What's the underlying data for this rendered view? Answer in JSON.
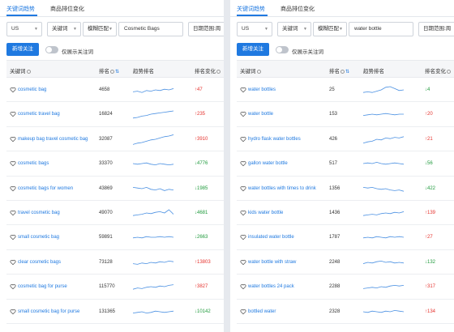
{
  "panels": [
    {
      "tabs": [
        "关键词趋势",
        "商品排位变化"
      ],
      "site": "US",
      "field": "关键词",
      "match": "模糊匹配",
      "query": "Cosmetic Bags",
      "range": "日期范围:周",
      "add_label": "新增关注",
      "toggle_label": "仅展示关注词",
      "headers": {
        "keyword": "关键词",
        "rank": "排名",
        "trend": "趋势排名",
        "change": "排名变化"
      },
      "rows": [
        {
          "keyword": "cosmetic bag",
          "rank": "4658",
          "change": "↑47",
          "dir": "up",
          "trend": [
            0.35,
            0.4,
            0.3,
            0.45,
            0.4,
            0.5,
            0.45,
            0.55,
            0.5,
            0.6
          ]
        },
        {
          "keyword": "cosmetic travel bag",
          "rank": "16824",
          "change": "↑235",
          "dir": "up",
          "trend": [
            0.2,
            0.25,
            0.35,
            0.4,
            0.5,
            0.55,
            0.6,
            0.65,
            0.7,
            0.75
          ]
        },
        {
          "keyword": "makeup bag travel cosmetic bag",
          "rank": "32087",
          "change": "↑3910",
          "dir": "up",
          "trend": [
            0.1,
            0.2,
            0.25,
            0.35,
            0.45,
            0.5,
            0.6,
            0.7,
            0.75,
            0.85
          ]
        },
        {
          "keyword": "cosmetic bags",
          "rank": "33370",
          "change": "↓4776",
          "dir": "down",
          "trend": [
            0.5,
            0.45,
            0.5,
            0.55,
            0.45,
            0.4,
            0.5,
            0.45,
            0.4,
            0.45
          ]
        },
        {
          "keyword": "cosmetic bags for women",
          "rank": "43869",
          "change": "↓1985",
          "dir": "down",
          "trend": [
            0.6,
            0.55,
            0.5,
            0.6,
            0.45,
            0.4,
            0.5,
            0.35,
            0.45,
            0.4
          ]
        },
        {
          "keyword": "travel cosmetic bag",
          "rank": "49070",
          "change": "↓4681",
          "dir": "down",
          "trend": [
            0.3,
            0.35,
            0.4,
            0.5,
            0.45,
            0.55,
            0.6,
            0.5,
            0.75,
            0.4
          ]
        },
        {
          "keyword": "small cosmetic bag",
          "rank": "59891",
          "change": "↓2663",
          "dir": "down",
          "trend": [
            0.45,
            0.5,
            0.45,
            0.55,
            0.5,
            0.5,
            0.55,
            0.5,
            0.55,
            0.5
          ]
        },
        {
          "keyword": "clear cosmetic bags",
          "rank": "73128",
          "change": "↑13803",
          "dir": "up",
          "trend": [
            0.4,
            0.35,
            0.45,
            0.4,
            0.5,
            0.45,
            0.55,
            0.5,
            0.6,
            0.55
          ]
        },
        {
          "keyword": "cosmetic bag for purse",
          "rank": "115770",
          "change": "↑3827",
          "dir": "up",
          "trend": [
            0.3,
            0.4,
            0.35,
            0.45,
            0.5,
            0.45,
            0.55,
            0.5,
            0.6,
            0.65
          ]
        },
        {
          "keyword": "small cosmetic bag for purse",
          "rank": "131365",
          "change": "↓10142",
          "dir": "down",
          "trend": [
            0.4,
            0.45,
            0.5,
            0.4,
            0.45,
            0.55,
            0.5,
            0.45,
            0.5,
            0.55
          ]
        }
      ]
    },
    {
      "tabs": [
        "关键词趋势",
        "商品排位变化"
      ],
      "site": "US",
      "field": "关键词",
      "match": "模糊匹配",
      "query": "water bottle",
      "range": "日期范围:周",
      "add_label": "新增关注",
      "toggle_label": "仅展示关注词",
      "headers": {
        "keyword": "关键词",
        "rank": "排名",
        "trend": "趋势排名",
        "change": "排名变化"
      },
      "rows": [
        {
          "keyword": "water bottles",
          "rank": "25",
          "change": "↓4",
          "dir": "down",
          "trend": [
            0.3,
            0.35,
            0.3,
            0.4,
            0.5,
            0.7,
            0.75,
            0.6,
            0.45,
            0.5
          ]
        },
        {
          "keyword": "water bottle",
          "rank": "153",
          "change": "↑20",
          "dir": "up",
          "trend": [
            0.4,
            0.45,
            0.5,
            0.45,
            0.5,
            0.55,
            0.5,
            0.45,
            0.5,
            0.5
          ]
        },
        {
          "keyword": "hydro flask water bottles",
          "rank": "426",
          "change": "↑21",
          "dir": "up",
          "trend": [
            0.2,
            0.3,
            0.35,
            0.5,
            0.45,
            0.6,
            0.55,
            0.65,
            0.6,
            0.7
          ]
        },
        {
          "keyword": "gallon water bottle",
          "rank": "517",
          "change": "↓56",
          "dir": "down",
          "trend": [
            0.5,
            0.55,
            0.5,
            0.6,
            0.5,
            0.45,
            0.5,
            0.55,
            0.5,
            0.45
          ]
        },
        {
          "keyword": "water bottles with times to drink",
          "rank": "1356",
          "change": "↓422",
          "dir": "down",
          "trend": [
            0.6,
            0.55,
            0.6,
            0.5,
            0.45,
            0.5,
            0.4,
            0.35,
            0.4,
            0.3
          ]
        },
        {
          "keyword": "kids water bottle",
          "rank": "1436",
          "change": "↑139",
          "dir": "up",
          "trend": [
            0.3,
            0.35,
            0.4,
            0.35,
            0.45,
            0.5,
            0.45,
            0.55,
            0.5,
            0.6
          ]
        },
        {
          "keyword": "insulated water bottle",
          "rank": "1787",
          "change": "↑27",
          "dir": "up",
          "trend": [
            0.45,
            0.5,
            0.45,
            0.55,
            0.5,
            0.45,
            0.55,
            0.5,
            0.55,
            0.5
          ]
        },
        {
          "keyword": "water bottle with straw",
          "rank": "2248",
          "change": "↓132",
          "dir": "down",
          "trend": [
            0.4,
            0.5,
            0.45,
            0.55,
            0.6,
            0.5,
            0.55,
            0.45,
            0.5,
            0.45
          ]
        },
        {
          "keyword": "water bottles 24 pack",
          "rank": "2288",
          "change": "↑317",
          "dir": "up",
          "trend": [
            0.35,
            0.4,
            0.45,
            0.4,
            0.5,
            0.45,
            0.55,
            0.6,
            0.55,
            0.6
          ]
        },
        {
          "keyword": "bottled water",
          "rank": "2328",
          "change": "↑134",
          "dir": "up",
          "trend": [
            0.5,
            0.45,
            0.55,
            0.5,
            0.45,
            0.55,
            0.5,
            0.6,
            0.55,
            0.5
          ]
        }
      ]
    }
  ],
  "colors": {
    "accent": "#1f79e0",
    "up": "#e5322d",
    "down": "#1f9a3c",
    "spark": "#4a90e2"
  },
  "icons": {
    "heart": "heart-outline-icon",
    "caret": "chevron-down-icon",
    "help": "question-circle-icon",
    "sort": "sort-icon"
  }
}
